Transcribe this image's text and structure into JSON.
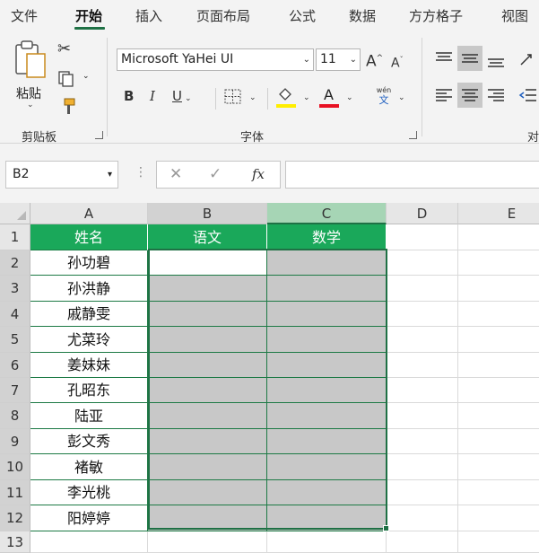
{
  "tabs": [
    "文件",
    "开始",
    "插入",
    "页面布局",
    "公式",
    "数据",
    "方方格子",
    "视图"
  ],
  "ribbon": {
    "clipboard": {
      "paste_label": "粘贴",
      "group_label": "剪贴板"
    },
    "font": {
      "family": "Microsoft YaHei UI",
      "size": "11",
      "bold": "B",
      "italic": "I",
      "underline": "U",
      "font_color_glyph": "A",
      "phonetic_top": "wén",
      "phonetic_bottom": "文",
      "group_label": "字体",
      "grow_glyph": "A",
      "shrink_glyph": "A"
    },
    "alignment": {
      "group_label_partial": "对"
    },
    "colors": {
      "fill": "#ffee00",
      "font": "#e81123"
    }
  },
  "formula_bar": {
    "name_box": "B2",
    "fx_label": "fx",
    "value": ""
  },
  "grid": {
    "columns": [
      "A",
      "B",
      "C",
      "D",
      "E"
    ],
    "rows": [
      "1",
      "2",
      "3",
      "4",
      "5",
      "6",
      "7",
      "8",
      "9",
      "10",
      "11",
      "12",
      "13"
    ],
    "headers": [
      "姓名",
      "语文",
      "数学"
    ],
    "names": [
      "孙功碧",
      "孙洪静",
      "戚静雯",
      "尤菜玲",
      "姜妹妹",
      "孔昭东",
      "陆亚",
      "彭文秀",
      "褚敏",
      "李光桃",
      "阳婷婷"
    ]
  },
  "colors": {
    "accent": "#1f7145",
    "header_fill": "#1aa85a",
    "selection": "#c8c8c8",
    "sel_col_header": "#a6d5b5"
  }
}
